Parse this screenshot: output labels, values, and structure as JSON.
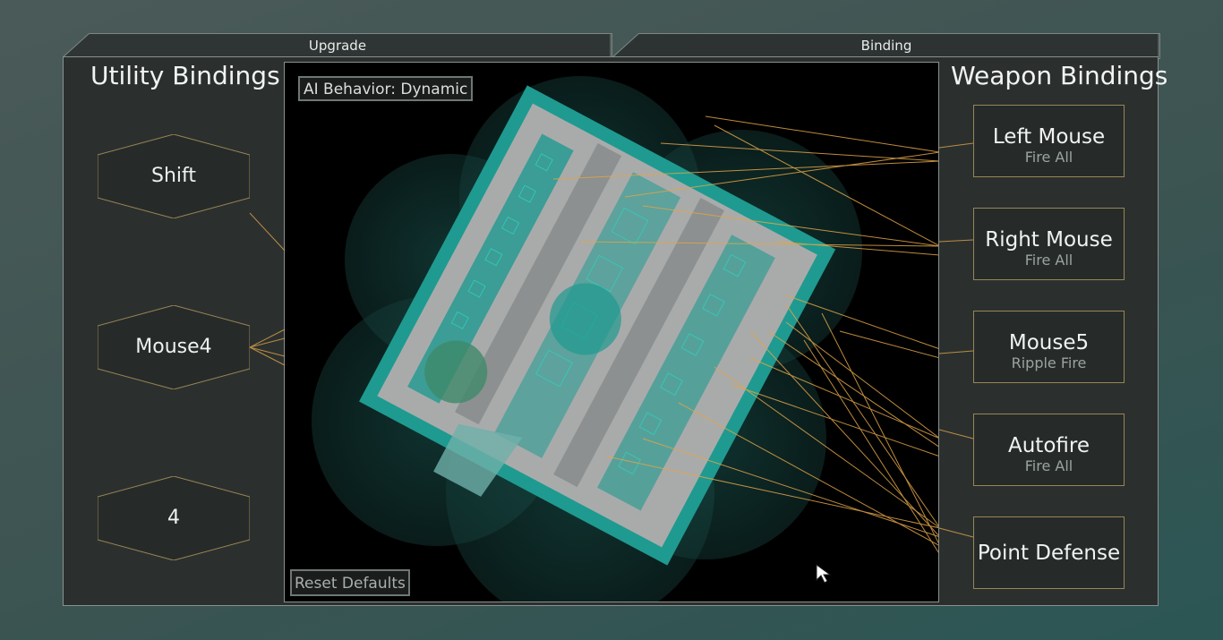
{
  "tabs": [
    {
      "label": "Upgrade",
      "active": false
    },
    {
      "label": "Binding",
      "active": true
    }
  ],
  "utility": {
    "title": "Utility Bindings",
    "buttons": [
      {
        "label": "Shift"
      },
      {
        "label": "Mouse4"
      },
      {
        "label": "4"
      }
    ]
  },
  "weapons": {
    "title": "Weapon Bindings",
    "buttons": [
      {
        "label": "Left Mouse",
        "mode": "Fire All"
      },
      {
        "label": "Right Mouse",
        "mode": "Fire All"
      },
      {
        "label": "Mouse5",
        "mode": "Ripple Fire"
      },
      {
        "label": "Autofire",
        "mode": "Fire All"
      },
      {
        "label": "Point Defense",
        "mode": ""
      }
    ]
  },
  "viewport": {
    "ai_behavior": "AI Behavior: Dynamic",
    "reset_label": "Reset Defaults"
  },
  "colors": {
    "accent_line": "#e0a448",
    "ship_gray": "#a9abab",
    "ship_teal": "#1f9a90",
    "shield_teal": "#1c5a55",
    "button_border": "#9a8552"
  },
  "icons": {
    "cursor": "mouse-pointer-icon"
  }
}
